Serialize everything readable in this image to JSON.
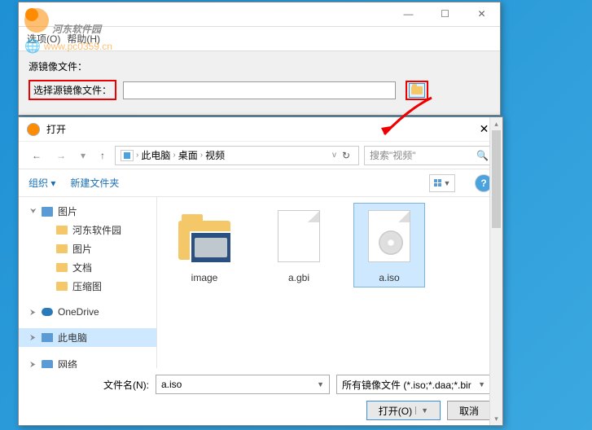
{
  "watermark": {
    "title": "河东软件园",
    "url": "www.pc0359.cn"
  },
  "parent": {
    "menu": {
      "options": "选项(O)",
      "help": "帮助(H)"
    },
    "label_source": "源镜像文件：",
    "label_select_source": "选择源镜像文件：",
    "path_value": ""
  },
  "dialog": {
    "title": "打开",
    "breadcrumb": {
      "p1": "此电脑",
      "p2": "桌面",
      "p3": "视频"
    },
    "search_placeholder": "搜索\"视频\"",
    "toolbar": {
      "organize": "组织 ▾",
      "new_folder": "新建文件夹"
    },
    "sidebar": {
      "pictures": "图片",
      "hedong": "河东软件园",
      "pictures2": "图片",
      "documents": "文档",
      "archive": "压缩图",
      "onedrive": "OneDrive",
      "thispc": "此电脑",
      "network": "网络"
    },
    "files": {
      "f1": "image",
      "f2": "a.gbi",
      "f3": "a.iso"
    },
    "footer": {
      "filename_label": "文件名(N):",
      "filename_value": "a.iso",
      "filter": "所有镜像文件 (*.iso;*.daa;*.bir",
      "open": "打开(O)",
      "cancel": "取消"
    }
  }
}
